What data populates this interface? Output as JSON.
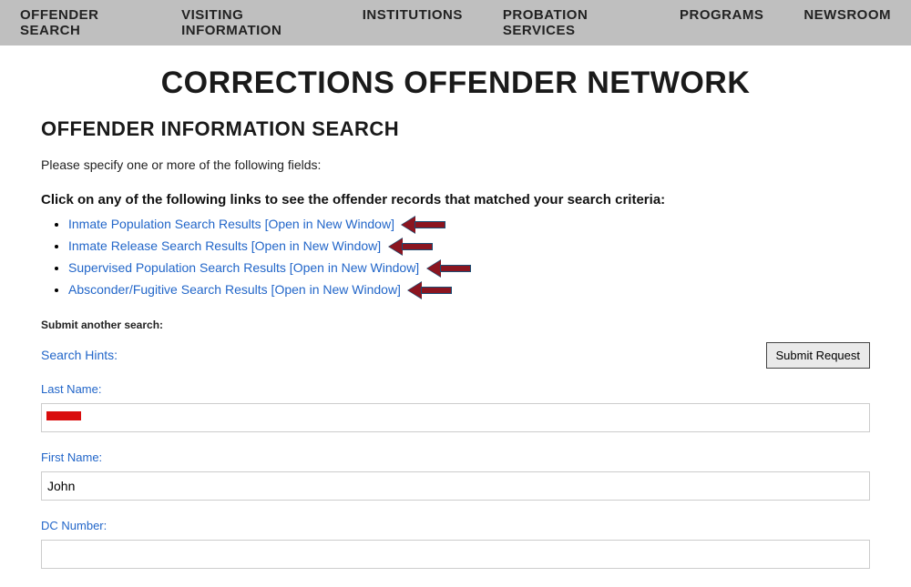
{
  "nav": {
    "items": [
      {
        "label": "OFFENDER SEARCH"
      },
      {
        "label": "VISITING INFORMATION"
      },
      {
        "label": "INSTITUTIONS"
      },
      {
        "label": "PROBATION SERVICES"
      },
      {
        "label": "PROGRAMS"
      },
      {
        "label": "NEWSROOM"
      }
    ]
  },
  "page": {
    "title": "CORRECTIONS OFFENDER NETWORK",
    "sub_title": "OFFENDER INFORMATION SEARCH",
    "intro": "Please specify one or more of the following fields:",
    "criteria_heading": "Click on any of the following links to see the offender records that matched your search criteria:"
  },
  "results": [
    {
      "label": "Inmate Population Search Results [Open in New Window]"
    },
    {
      "label": "Inmate Release Search Results [Open in New Window]"
    },
    {
      "label": "Supervised Population Search Results [Open in New Window]"
    },
    {
      "label": "Absconder/Fugitive Search Results [Open in New Window]"
    }
  ],
  "form": {
    "submit_another": "Submit another search:",
    "search_hints": "Search Hints:",
    "submit_button": "Submit Request",
    "fields": {
      "last_name": {
        "label": "Last Name:",
        "value": ""
      },
      "first_name": {
        "label": "First Name:",
        "value": "John"
      },
      "dc_number": {
        "label": "DC Number:",
        "value": ""
      }
    }
  }
}
